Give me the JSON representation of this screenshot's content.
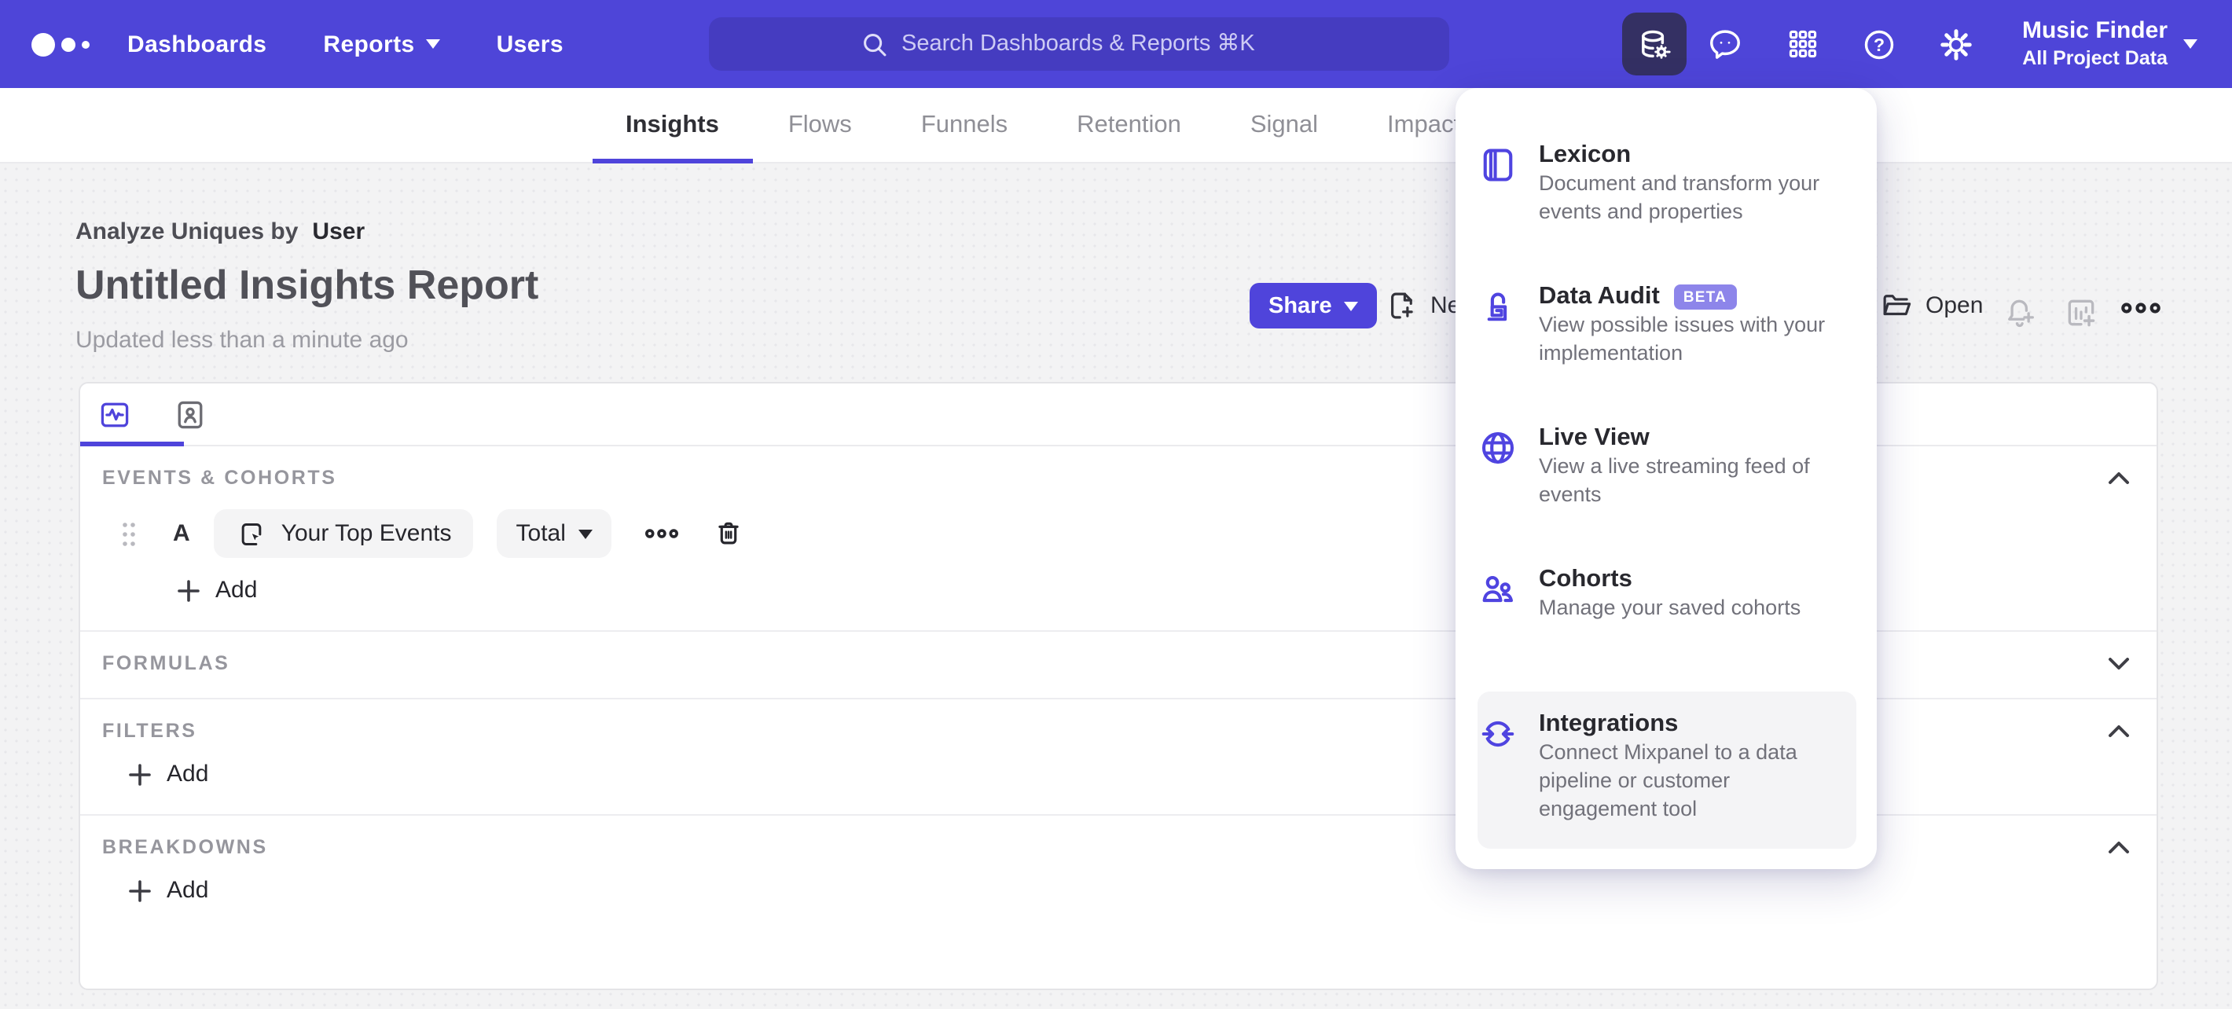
{
  "colors": {
    "navbar": "#4e45d8",
    "accent": "#4f44db",
    "active_tile": "#343063",
    "beta_badge": "#8d85ea",
    "page_background": "#f3f3f4"
  },
  "navbar": {
    "nav_items": [
      {
        "label": "Dashboards",
        "has_caret": false
      },
      {
        "label": "Reports",
        "has_caret": true
      },
      {
        "label": "Users",
        "has_caret": false
      }
    ],
    "search_placeholder": "Search Dashboards & Reports ⌘K",
    "icons": [
      "data-management-icon",
      "feedback-bubble-icon",
      "apps-grid-icon",
      "help-icon",
      "settings-gear-icon"
    ],
    "project_name": "Music Finder",
    "project_scope": "All Project Data"
  },
  "report_tabs": {
    "active": "Insights",
    "items": [
      {
        "label": "Insights"
      },
      {
        "label": "Flows"
      },
      {
        "label": "Funnels"
      },
      {
        "label": "Retention"
      },
      {
        "label": "Signal"
      },
      {
        "label": "Impact"
      }
    ]
  },
  "header": {
    "analyze_prefix": "Analyze Uniques by",
    "analyze_entity": "User",
    "title": "Untitled Insights Report",
    "updated": "Updated less than a minute ago",
    "share_label": "Share",
    "new_label": "New",
    "open_label": "Open"
  },
  "builder": {
    "sections": [
      {
        "label": "EVENTS & COHORTS",
        "collapsed": false
      },
      {
        "label": "FORMULAS",
        "collapsed": true
      },
      {
        "label": "FILTERS",
        "collapsed": false
      },
      {
        "label": "BREAKDOWNS",
        "collapsed": false
      }
    ],
    "event_row": {
      "letter": "A",
      "event": "Your Top Events",
      "aggregation": "Total"
    },
    "add_label": "Add"
  },
  "menu": {
    "items": [
      {
        "title": "Lexicon",
        "description": "Document and transform your events and properties",
        "icon": "lexicon-book-icon"
      },
      {
        "title": "Data Audit",
        "badge": "BETA",
        "description": "View possible issues with your implementation",
        "icon": "data-audit-lock-icon"
      },
      {
        "title": "Live View",
        "description": "View a live streaming feed of events",
        "icon": "live-view-globe-icon"
      },
      {
        "title": "Cohorts",
        "description": "Manage your saved cohorts",
        "icon": "cohorts-people-icon"
      },
      {
        "title": "Integrations",
        "description": "Connect Mixpanel to a data pipeline or customer engagement tool",
        "icon": "integrations-sync-icon",
        "highlighted": true
      }
    ]
  }
}
